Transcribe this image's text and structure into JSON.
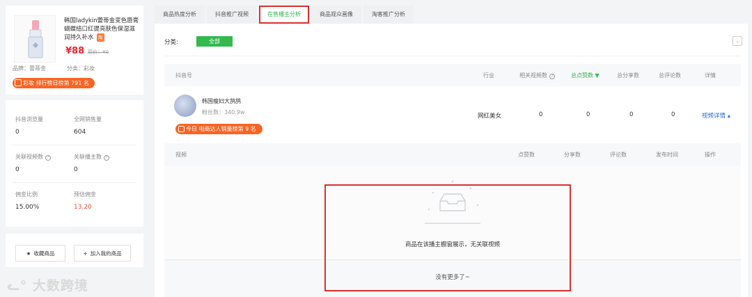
{
  "product": {
    "title": "韩国ladykin蕾蒂金变色唇膏蝴蝶结口红提亮肤色保湿滋润持久补水",
    "hot_badge": "淘",
    "price": "¥88",
    "orig_price": "原价：¥0",
    "brand": "品牌：蕾蒂金",
    "category": "分类：彩妆",
    "rank": "彩妆 排行榜日榜第 791 名"
  },
  "stats": [
    {
      "label": "抖音浏览量",
      "value": "0"
    },
    {
      "label": "全网销售量",
      "value": "604"
    },
    {
      "label": "关联视频数",
      "value": "0"
    },
    {
      "label": "关联播主数",
      "value": "0"
    },
    {
      "label": "佣金比例",
      "value": "15.00%"
    },
    {
      "label": "预估佣金",
      "value": "13.20"
    }
  ],
  "buttons": {
    "favorite": "收藏商品",
    "add_mine": "加入我的商品"
  },
  "watermark": "大数跨境",
  "tabs": [
    {
      "label": "商品热度分析",
      "active": false
    },
    {
      "label": "抖音推广视频",
      "active": false
    },
    {
      "label": "在售播主分析",
      "active": true
    },
    {
      "label": "商品观众画像",
      "active": false
    },
    {
      "label": "淘客推广分析",
      "active": false
    }
  ],
  "filter": {
    "label": "分类:",
    "all": "全部"
  },
  "table": {
    "headers": [
      "抖音号",
      "行业",
      "相关视频数",
      "总点赞数",
      "总分享数",
      "总评论数",
      "详情"
    ],
    "row": {
      "name": "韩国瘦妇大鸹鸹",
      "fans": "粉丝数：340.9w",
      "rank": "今日 电商达人销量榜第 9 名",
      "industry": "网红美女",
      "videos": "0",
      "likes": "0",
      "shares": "0",
      "comments": "0",
      "detail": "视频详情 ▴"
    }
  },
  "subtable": {
    "headers": [
      "视频",
      "点赞数",
      "分享数",
      "评论数",
      "发布时间",
      "操作"
    ],
    "empty_msg": "商品在该播主橱窗展示，无关联视频",
    "no_more": "没有更多了~"
  },
  "colors": {
    "accent_green": "#33b94d",
    "rank_orange": "#f96424",
    "price_red": "#f5222d",
    "link_blue": "#2a6fd6",
    "highlight_red": "#d9302e"
  }
}
